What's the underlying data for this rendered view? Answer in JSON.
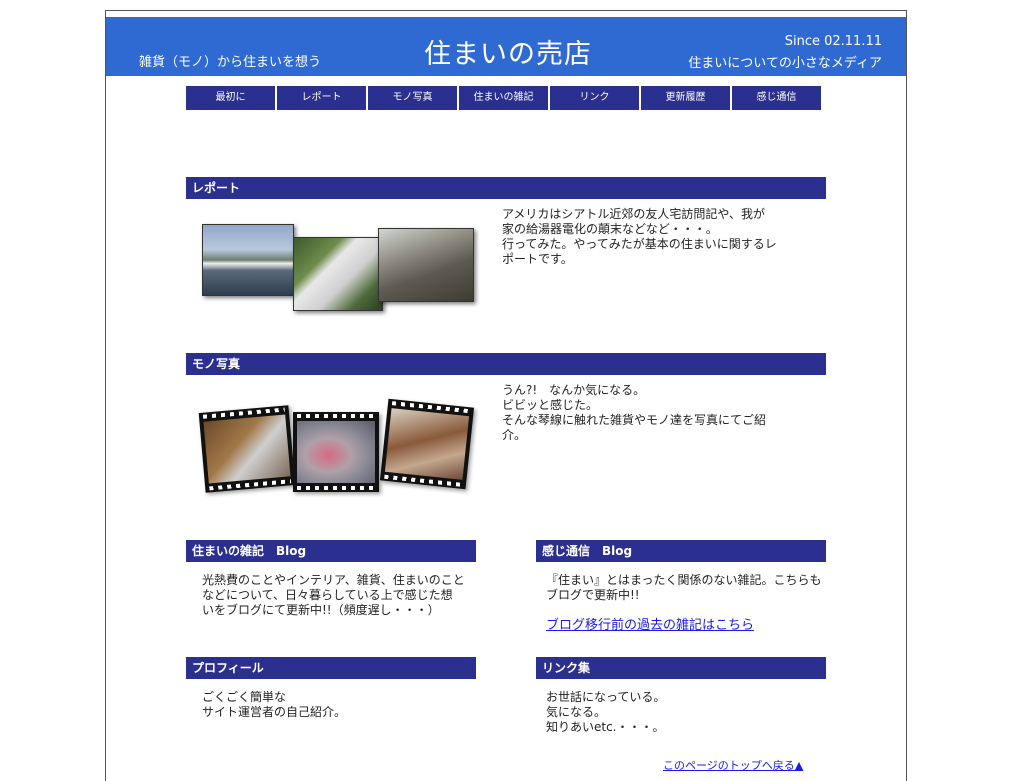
{
  "header": {
    "tagline_left": "雑貨（モノ）から住まいを想う",
    "title": "住まいの売店",
    "since": "Since 02.11.11",
    "tagline_right": "住まいについての小さなメディア"
  },
  "nav": [
    "最初に",
    "レポート",
    "モノ写真",
    "住まいの雑記",
    "リンク",
    "更新履歴",
    "感じ通信"
  ],
  "report": {
    "heading": "レポート",
    "text1": "アメリカはシアトル近郊の友人宅訪問記や、我が",
    "text2": "家の給湯器電化の顛末などなど・・・。",
    "text3": "行ってみた。やってみたが基本の住まいに関するレ",
    "text4": "ポートです。"
  },
  "mono": {
    "heading": "モノ写真",
    "text1": "うん?!　なんか気になる。",
    "text2": "ビビッと感じた。",
    "text3": "そんな琴線に触れた雑貨やモノ達を写真にてご紹",
    "text4": "介。"
  },
  "blog1": {
    "heading": "住まいの雑記　Blog",
    "text1": "光熱費のことやインテリア、雑貨、住まいのこと",
    "text2": "などについて、日々暮らしている上で感じた想",
    "text3": "いをブログにて更新中!!（頻度遅し・・・）"
  },
  "blog2": {
    "heading": "感じ通信　Blog",
    "text1": "『住まい』とはまったく関係のない雑記。こちらも",
    "text2": "ブログで更新中!!",
    "link": "ブログ移行前の過去の雑記はこちら"
  },
  "profile": {
    "heading": "プロフィール",
    "text1": "ごくごく簡単な",
    "text2": "サイト運営者の自己紹介。"
  },
  "links": {
    "heading": "リンク集",
    "text1": "お世話になっている。",
    "text2": "気になる。",
    "text3": "知りあいetc.・・・。"
  },
  "footer": {
    "top_link": "このページのトップへ戻る▲"
  },
  "colors": {
    "header_bg": "#2e6ad2",
    "bar_bg": "#2b2f8f",
    "link": "#1a1aee"
  }
}
